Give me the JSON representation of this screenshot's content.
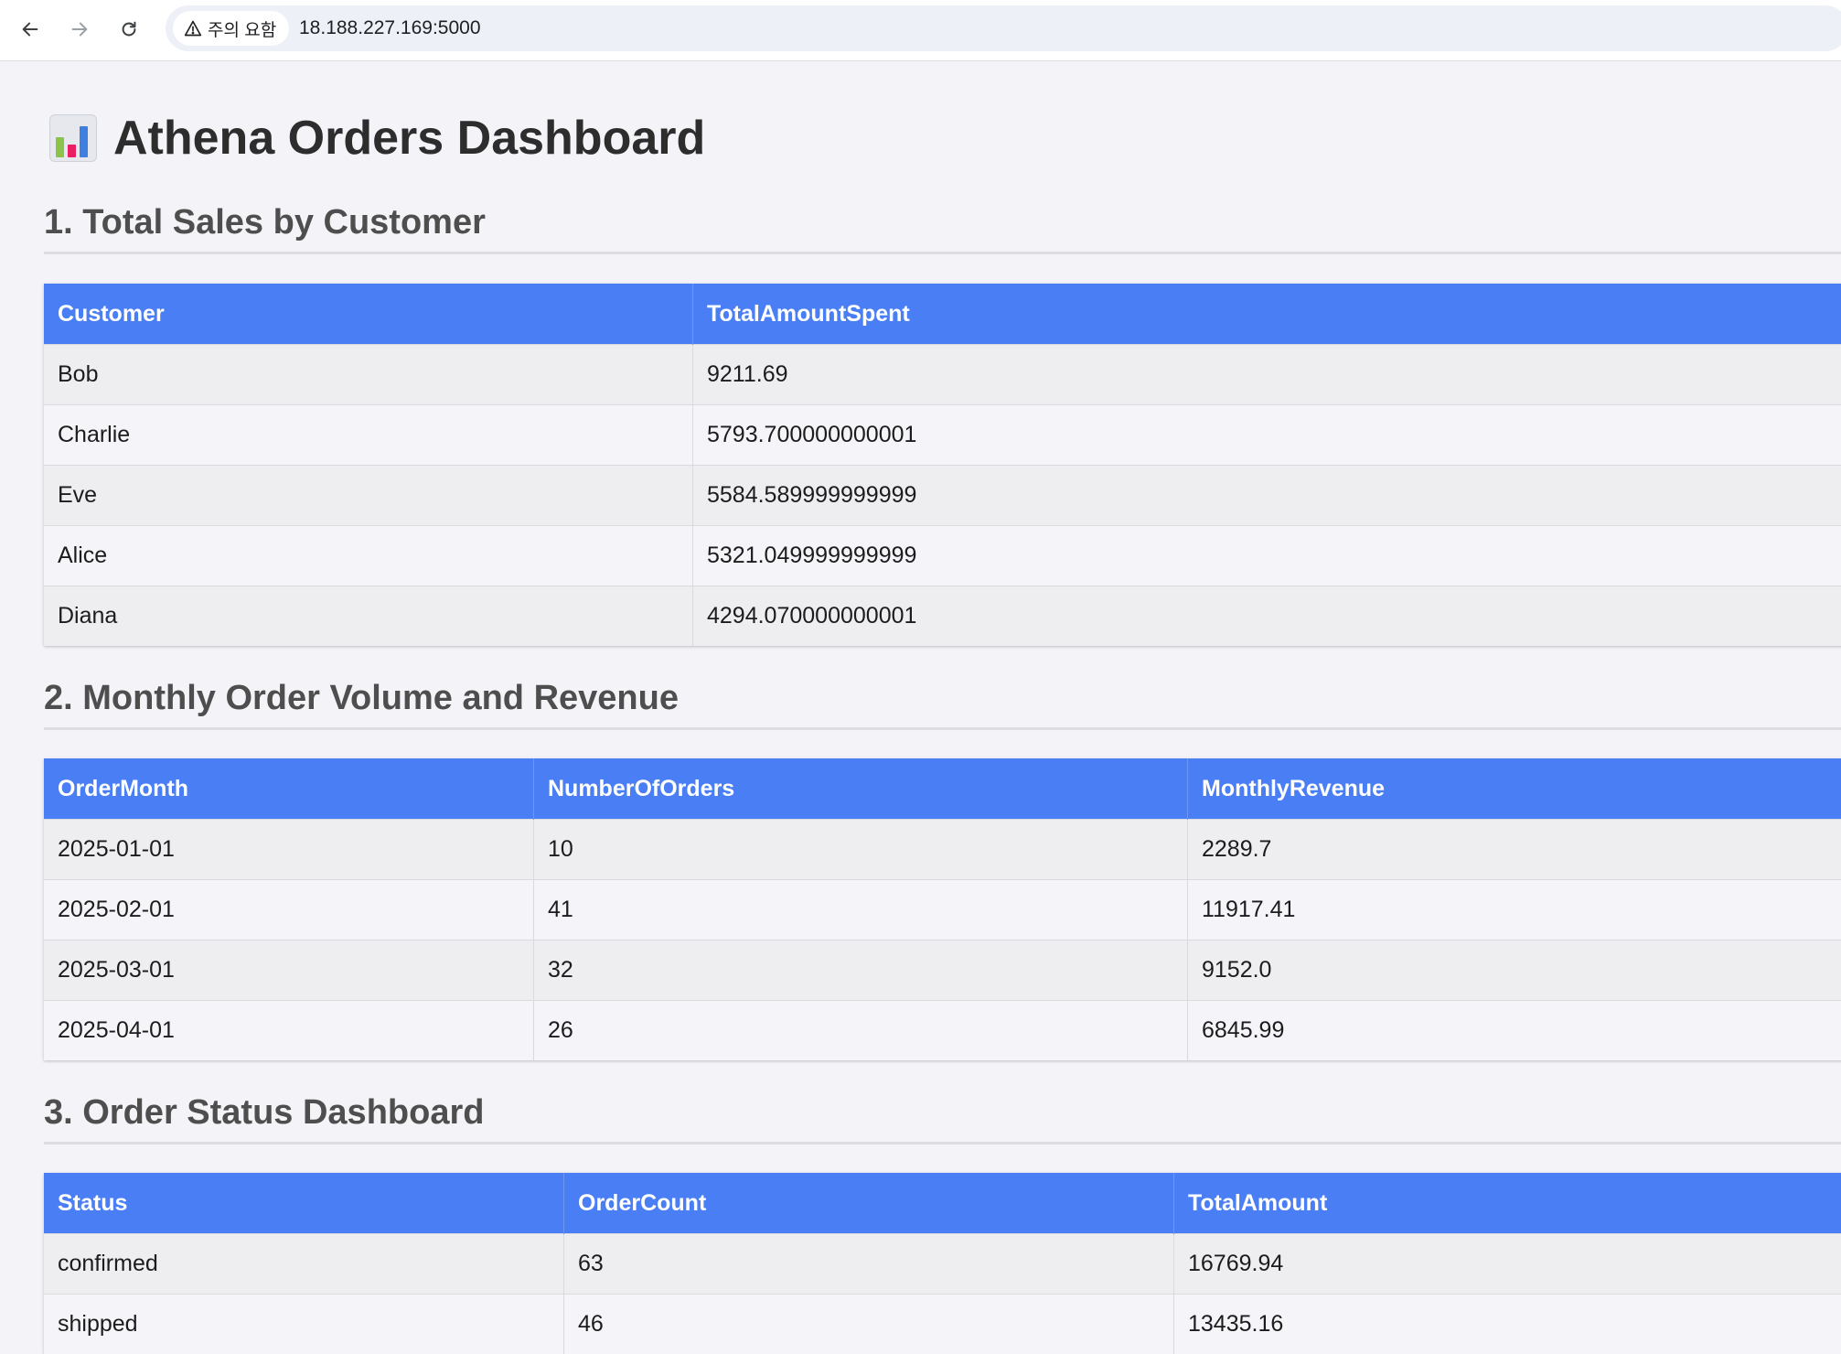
{
  "browser": {
    "security_label": "주의 요함",
    "url": "18.188.227.169:5000"
  },
  "page": {
    "title": "Athena Orders Dashboard",
    "title_icon": "bar-chart-emoji"
  },
  "sections": [
    {
      "title": "1. Total Sales by Customer",
      "columns": [
        "Customer",
        "TotalAmountSpent"
      ],
      "rows": [
        [
          "Bob",
          "9211.69"
        ],
        [
          "Charlie",
          "5793.700000000001"
        ],
        [
          "Eve",
          "5584.589999999999"
        ],
        [
          "Alice",
          "5321.049999999999"
        ],
        [
          "Diana",
          "4294.070000000001"
        ]
      ]
    },
    {
      "title": "2. Monthly Order Volume and Revenue",
      "columns": [
        "OrderMonth",
        "NumberOfOrders",
        "MonthlyRevenue"
      ],
      "rows": [
        [
          "2025-01-01",
          "10",
          "2289.7"
        ],
        [
          "2025-02-01",
          "41",
          "11917.41"
        ],
        [
          "2025-03-01",
          "32",
          "9152.0"
        ],
        [
          "2025-04-01",
          "26",
          "6845.99"
        ]
      ]
    },
    {
      "title": "3. Order Status Dashboard",
      "columns": [
        "Status",
        "OrderCount",
        "TotalAmount"
      ],
      "rows": [
        [
          "confirmed",
          "63",
          "16769.94"
        ],
        [
          "shipped",
          "46",
          "13435.16"
        ]
      ]
    }
  ],
  "colors": {
    "header_bg": "#4a7ef5",
    "page_bg": "#f4f3f8"
  }
}
